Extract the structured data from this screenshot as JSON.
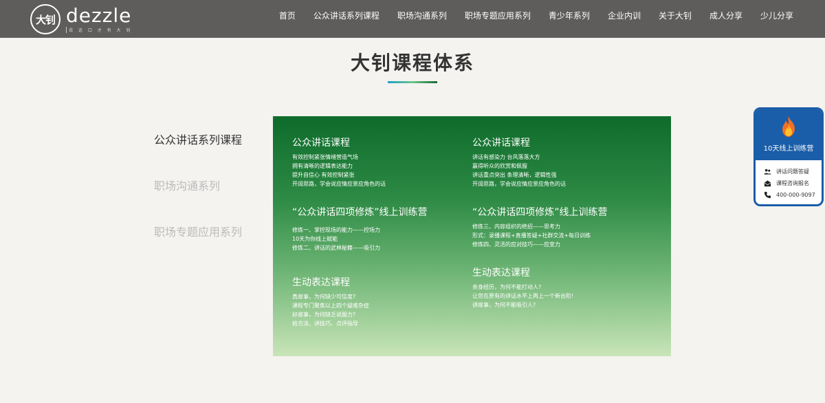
{
  "logo": {
    "circle_text": "大钊",
    "word": "dezzle",
    "tagline": "说 话 口 才 有 大 钊"
  },
  "nav": [
    "首页",
    "公众讲话系列课程",
    "职场沟通系列",
    "职场专题应用系列",
    "青少年系列",
    "企业内训",
    "关于大钊",
    "成人分享",
    "少儿分享"
  ],
  "page_title": "大钊课程体系",
  "side_menu": [
    {
      "label": "公众讲话系列课程",
      "active": true
    },
    {
      "label": "职场沟通系列",
      "active": false
    },
    {
      "label": "职场专题应用系列",
      "active": false
    }
  ],
  "card": {
    "left": [
      {
        "title": "公众讲话课程",
        "lines": [
          "有效控制紧张情绪营造气场",
          "拥有清晰的逻辑表达能力",
          "提升自信心 有效控制紧张",
          "开阔思路，学会说应情应景应角色的话"
        ]
      },
      {
        "title": "“公众讲话四项修炼”线上训练营",
        "lines": [
          "修炼一、掌控现场的能力——控场力",
          "10天为你线上赋能",
          "修炼二、讲话的武林秘籍——吸引力"
        ]
      },
      {
        "title": "生动表达课程",
        "lines": [
          "真故事，为何缺少可信度?",
          "课程专门聚焦以上四个疑难杂症",
          "好故事，为何缺乏说服力?",
          "给方法、讲技巧、点评指导"
        ]
      }
    ],
    "right": [
      {
        "title": "公众讲话课程",
        "lines": [
          "讲话有感染力 台风落落大方",
          "赢得听众的欣赏和佩服",
          "讲话重点突出 条理清晰，逻辑性强",
          "开阔思路，学会说应情应景应角色的话"
        ]
      },
      {
        "title": "“公众讲话四项修炼”线上训练营",
        "lines": [
          "修炼三、内容组织的绝招——思考力",
          "形式：录播课程+直播答疑+社群交流+每日训练",
          "修炼四、灵活的应对技巧——应变力"
        ]
      },
      {
        "title": "生动表达课程",
        "lines": [
          "亲身经历，为何不能打动人?",
          "让您在原有的讲话水平上再上一个新台阶!",
          "讲故事，为何不能吸引人?"
        ]
      }
    ]
  },
  "float_panel": {
    "title": "10天线上训练营",
    "items": [
      {
        "icon": "people-icon",
        "label": "讲话问题答疑"
      },
      {
        "icon": "mail-icon",
        "label": "课程咨询报名"
      },
      {
        "icon": "phone-icon",
        "label": "400-000-9097"
      }
    ]
  },
  "colors": {
    "header": "#5f5d5b",
    "card_top": "#0e6b2b",
    "card_bottom": "#c9e5b8",
    "float_border": "#1a5da8"
  }
}
